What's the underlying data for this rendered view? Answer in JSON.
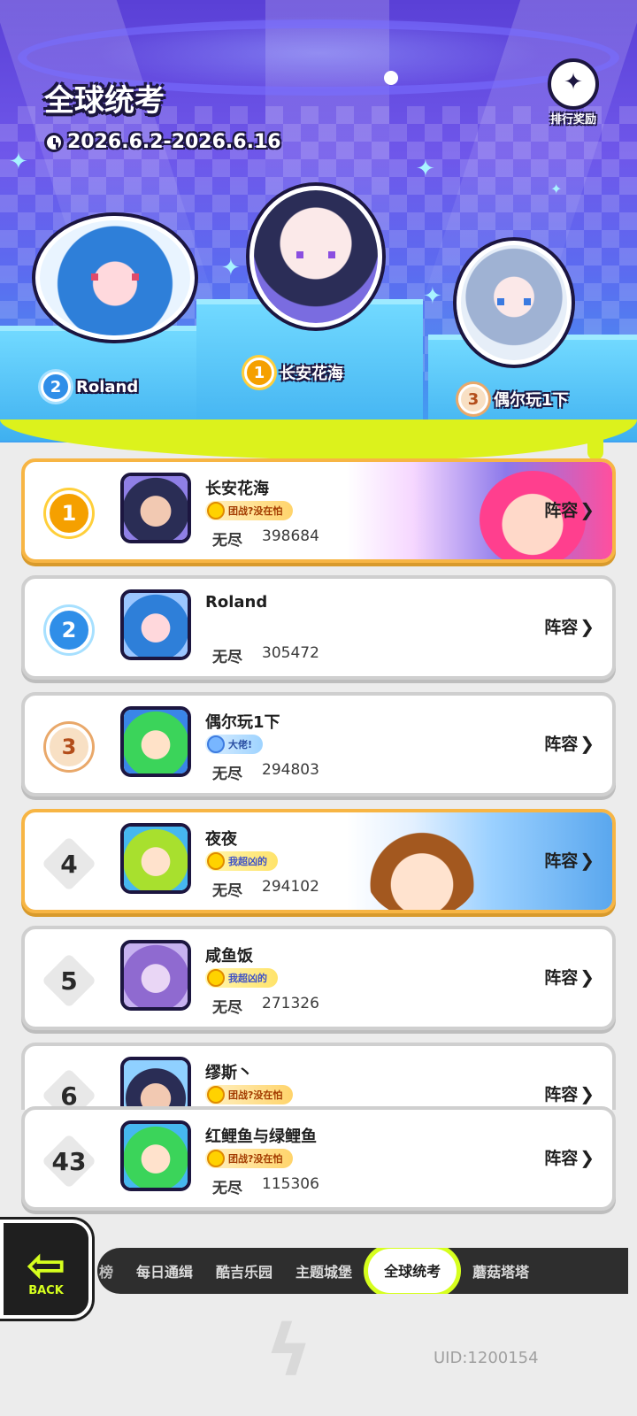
{
  "header": {
    "title": "全球统考",
    "date_range": "2026.6.2-2026.6.16",
    "reward_label": "排行奖励"
  },
  "podium": [
    {
      "rank": "1",
      "name": "长安花海"
    },
    {
      "rank": "2",
      "name": "Roland"
    },
    {
      "rank": "3",
      "name": "偶尔玩1下"
    }
  ],
  "list": [
    {
      "rank": "1",
      "name": "长安花海",
      "badge": "团战?没在怕",
      "mode": "无尽",
      "score": "398684",
      "lineup": "阵容"
    },
    {
      "rank": "2",
      "name": "Roland",
      "badge": "",
      "mode": "无尽",
      "score": "305472",
      "lineup": "阵容"
    },
    {
      "rank": "3",
      "name": "偶尔玩1下",
      "badge": "大佬!",
      "mode": "无尽",
      "score": "294803",
      "lineup": "阵容"
    },
    {
      "rank": "4",
      "name": "夜夜",
      "badge": "我超凶的",
      "mode": "无尽",
      "score": "294102",
      "lineup": "阵容"
    },
    {
      "rank": "5",
      "name": "咸鱼饭",
      "badge": "我超凶的",
      "mode": "无尽",
      "score": "271326",
      "lineup": "阵容"
    },
    {
      "rank": "6",
      "name": "缪斯丶",
      "badge": "团战?没在怕",
      "lineup": "阵容"
    }
  ],
  "self": {
    "rank": "43",
    "name": "红鲤鱼与绿鲤鱼",
    "badge": "团战?没在怕",
    "mode": "无尽",
    "score": "115306",
    "lineup": "阵容"
  },
  "nav": {
    "back_label": "BACK",
    "tabs": [
      "榜",
      "每日通缉",
      "酷吉乐园",
      "主题城堡",
      "全球统考",
      "蘑菇塔塔"
    ],
    "active_tab": "全球统考"
  },
  "footer": {
    "uid": "UID:1200154"
  },
  "colors": {
    "accent_lime": "#d6ff1e",
    "gold": "#f5a000",
    "highlight_border": "#f7b544"
  }
}
